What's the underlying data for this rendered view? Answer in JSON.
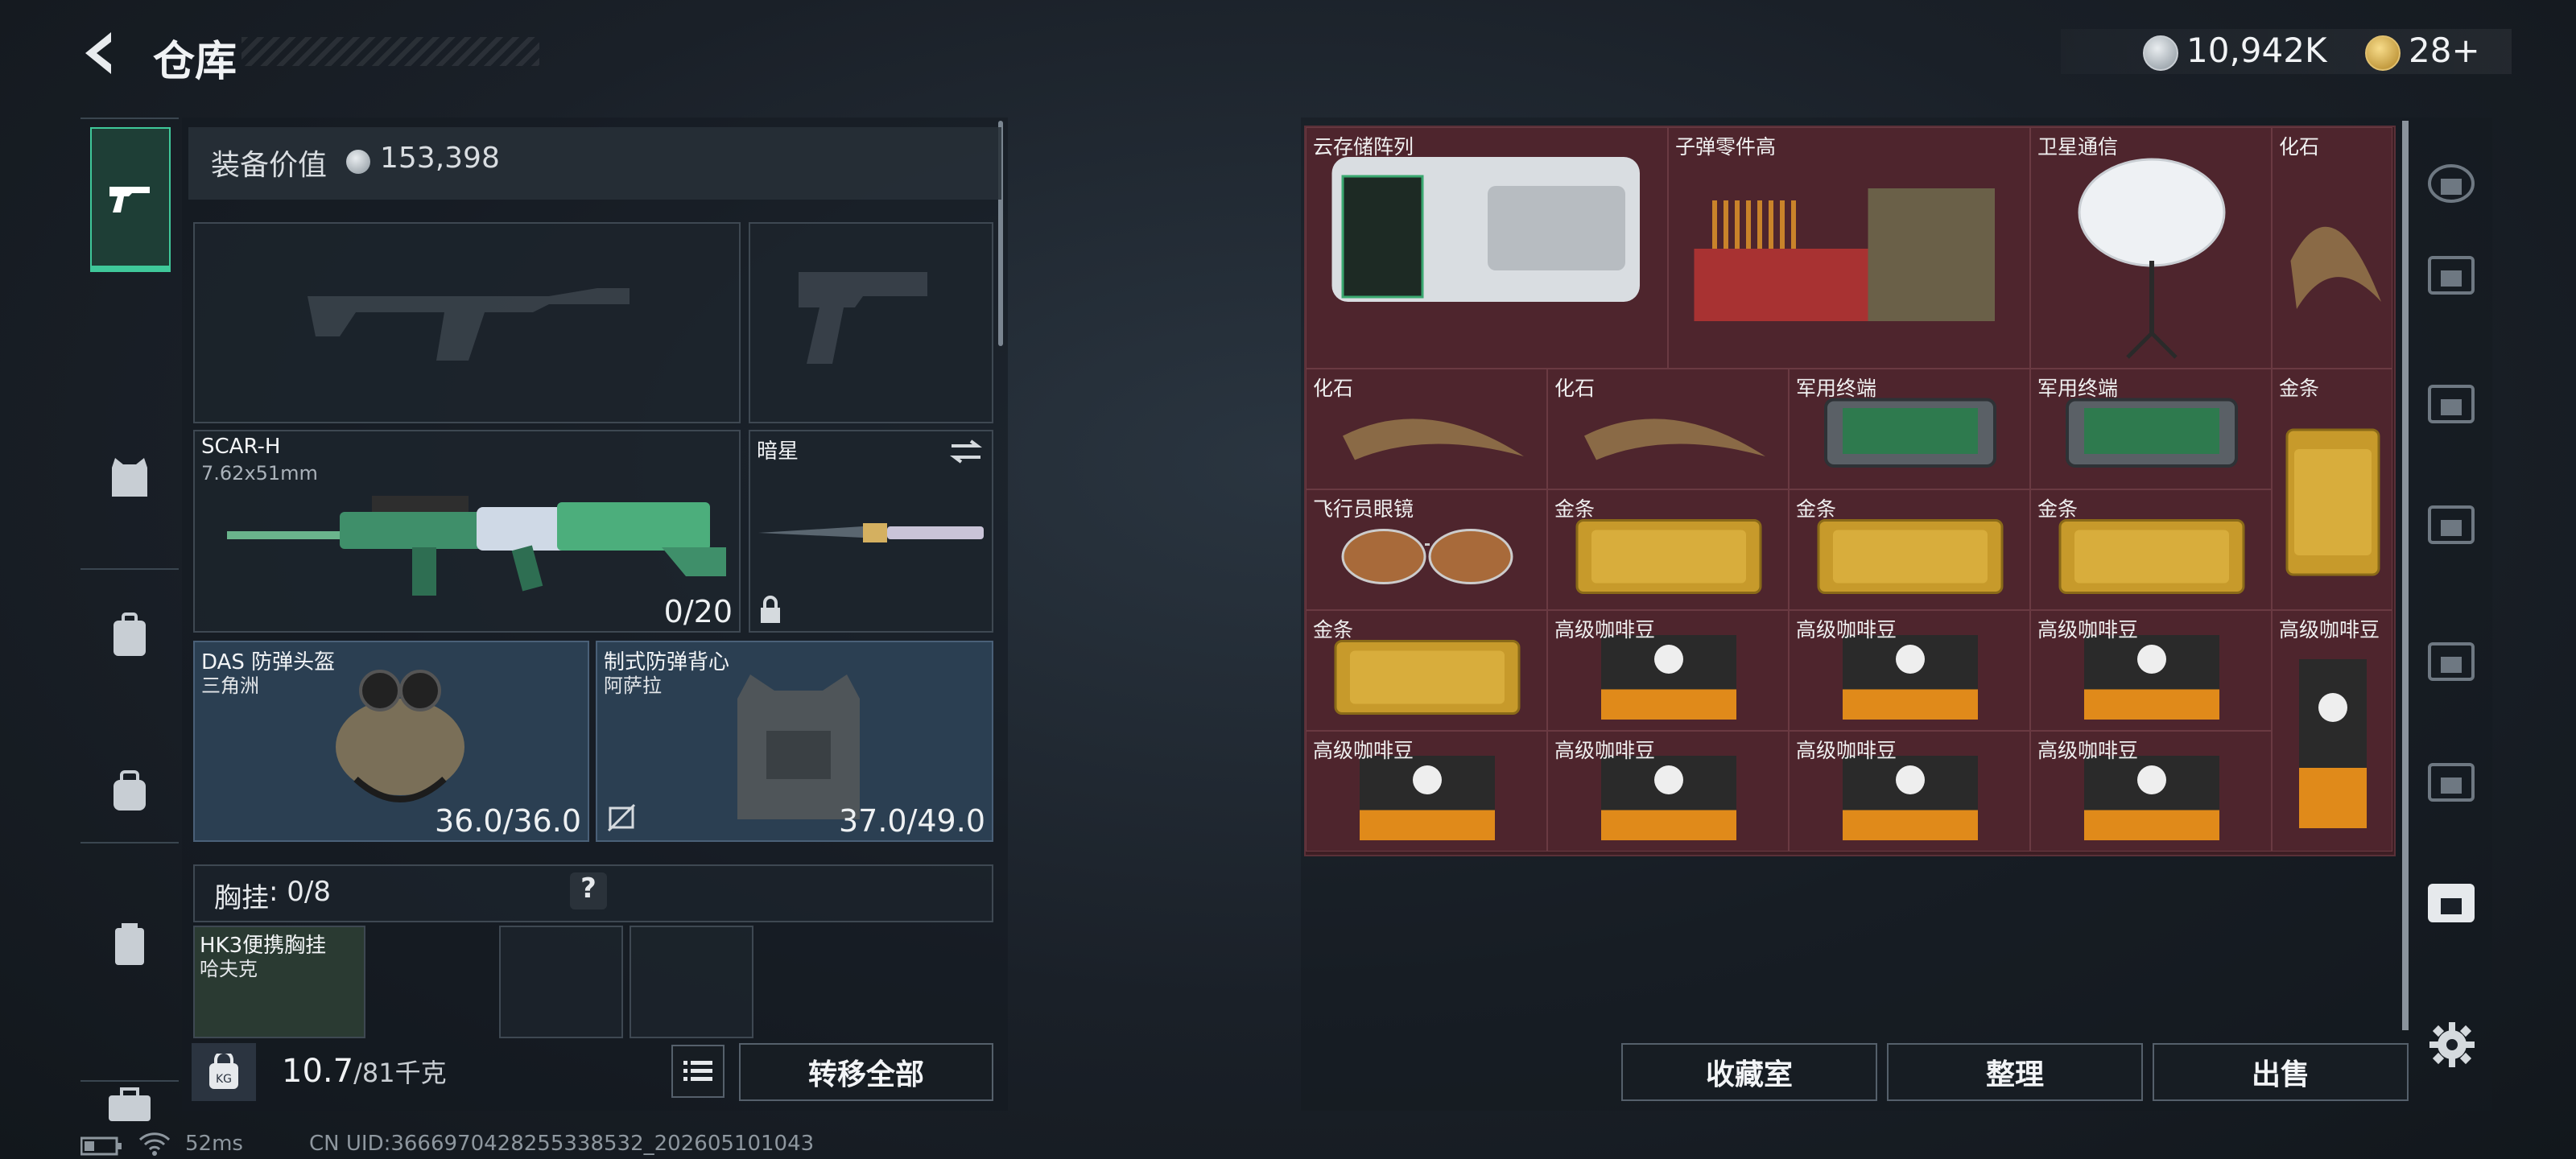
{
  "header": {
    "title": "仓库",
    "currency1_value": "10,942K",
    "currency2_value": "28+",
    "currency1_icon": "silver-coin-icon",
    "currency2_icon": "gold-token-icon"
  },
  "equipment": {
    "value_label": "装备价值",
    "value": "153,398",
    "weapon_main": {
      "name": "SCAR-H",
      "caliber": "7.62x51mm",
      "ammo": "0/20"
    },
    "melee": {
      "name": "暗星"
    },
    "helmet": {
      "name": "DAS 防弹头盔",
      "sub": "三角洲",
      "durability": "36.0/36.0"
    },
    "vest": {
      "name": "制式防弹背心",
      "sub": "阿萨拉",
      "durability": "37.0/49.0"
    },
    "chest_rig": {
      "label": "胸挂",
      "count": ": 0/8",
      "help": "?"
    },
    "chest_rig_item": {
      "name": "HK3便携胸挂",
      "sub": "哈夫克"
    }
  },
  "weight": {
    "current": "10.7",
    "max": "/81千克",
    "kg_icon": "KG"
  },
  "buttons": {
    "transfer_all": "转移全部",
    "collection": "收藏室",
    "sort": "整理",
    "sell": "出售"
  },
  "storage_items": [
    {
      "label": "云存储阵列",
      "kind": "server"
    },
    {
      "label": "子弹零件高",
      "kind": "ammo-crate"
    },
    {
      "label": "卫星通信",
      "kind": "satellite"
    },
    {
      "label": "化石",
      "kind": "claw"
    },
    {
      "label": "化石",
      "kind": "claw"
    },
    {
      "label": "化石",
      "kind": "claw"
    },
    {
      "label": "军用终端",
      "kind": "terminal"
    },
    {
      "label": "军用终端",
      "kind": "terminal"
    },
    {
      "label": "金条",
      "kind": "gold"
    },
    {
      "label": "飞行员眼镜",
      "kind": "glasses"
    },
    {
      "label": "金条",
      "kind": "gold"
    },
    {
      "label": "金条",
      "kind": "gold"
    },
    {
      "label": "金条",
      "kind": "gold"
    },
    {
      "label": "金条",
      "kind": "gold"
    },
    {
      "label": "高级咖啡豆",
      "kind": "coffee"
    },
    {
      "label": "高级咖啡豆",
      "kind": "coffee"
    },
    {
      "label": "高级咖啡豆",
      "kind": "coffee"
    },
    {
      "label": "高级咖啡豆",
      "kind": "coffee"
    },
    {
      "label": "高级咖啡豆",
      "kind": "coffee"
    },
    {
      "label": "高级咖啡豆",
      "kind": "coffee"
    },
    {
      "label": "高级咖啡豆",
      "kind": "coffee"
    },
    {
      "label": "高级咖啡豆",
      "kind": "coffee"
    }
  ],
  "right_nav": [
    "vault-icon",
    "iv-tier-icon",
    "iii-tier-icon",
    "iv-medical-icon",
    "iii-ammo-icon",
    "iv-folder-icon",
    "iv-selected-icon"
  ],
  "status": {
    "ping": "52ms",
    "uid": "CN UID:3666970428255338532_202605101043"
  }
}
